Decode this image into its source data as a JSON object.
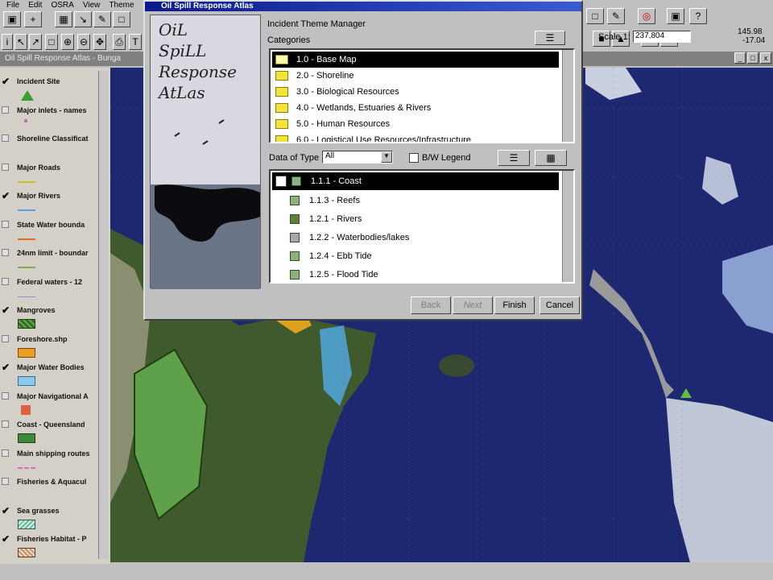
{
  "menu": [
    "File",
    "Edit",
    "OSRA",
    "View",
    "Theme"
  ],
  "app_title": "Oil Spill Response Atlas - Bunga",
  "scale": {
    "label": "Scale 1:",
    "value": "237,804"
  },
  "coords": {
    "x": "145.98",
    "y": "-17.04"
  },
  "legend": [
    {
      "label": "Incident Site",
      "checked": true,
      "symbol": "green-triangle"
    },
    {
      "label": "Major inlets - names",
      "checked": false,
      "symbol": "dot"
    },
    {
      "label": "Shoreline Classificat",
      "checked": false,
      "symbol": "none"
    },
    {
      "label": "Major Roads",
      "checked": false,
      "symbol": "yellow-line"
    },
    {
      "label": "Major Rivers",
      "checked": true,
      "symbol": "blue-line"
    },
    {
      "label": "State Water bounda",
      "checked": false,
      "symbol": "orange-line"
    },
    {
      "label": "24nm limit - boundar",
      "checked": false,
      "symbol": "green-line"
    },
    {
      "label": "Federal waters - 12",
      "checked": false,
      "symbol": "thin-line"
    },
    {
      "label": "Mangroves",
      "checked": true,
      "symbol": "green-hatch"
    },
    {
      "label": "Foreshore.shp",
      "checked": false,
      "symbol": "orange-fill"
    },
    {
      "label": "Major Water Bodies",
      "checked": true,
      "symbol": "light-blue-fill"
    },
    {
      "label": "Major Navigational A",
      "checked": false,
      "symbol": "red-marker"
    },
    {
      "label": "Coast - Queensland",
      "checked": false,
      "symbol": "green-fill"
    },
    {
      "label": "Main shipping routes",
      "checked": false,
      "symbol": "pink-line"
    },
    {
      "label": "Fisheries & Aquacul",
      "checked": false,
      "symbol": "none"
    },
    {
      "label": "Sea grasses",
      "checked": true,
      "symbol": "teal-hatch"
    },
    {
      "label": "Fisheries Habitat - P",
      "checked": true,
      "symbol": "brown-hatch"
    }
  ],
  "dialog": {
    "title": "Oil Spill Response Atlas",
    "logo_words": [
      "OiL",
      "SpiLL",
      "Response",
      "AtLas"
    ],
    "manager_title": "Incident Theme Manager",
    "categories_label": "Categories",
    "categories": [
      "1.0 - Base Map",
      "2.0 - Shoreline",
      "3.0 - Biological Resources",
      "4.0 - Wetlands, Estuaries & Rivers",
      "5.0 - Human Resources",
      "6.0 - Logistical Use Resources/Infrastructure"
    ],
    "data_of_type_label": "Data of Type",
    "data_of_type_value": "All",
    "bw_legend_label": "B/W Legend",
    "layers": [
      "1.1.1 - Coast",
      "1.1.3 - Reefs",
      "1.2.1 - Rivers",
      "1.2.2 - Waterbodies/lakes",
      "1.2.4 - Ebb Tide",
      "1.2.5 - Flood Tide"
    ],
    "buttons": {
      "back": "Back",
      "next": "Next",
      "finish": "Finish",
      "cancel": "Cancel"
    }
  },
  "colors": {
    "ocean": "#1d2870",
    "land": "#3f5a2c",
    "selection": "#000000",
    "title_bar": "#0b1a8a"
  }
}
